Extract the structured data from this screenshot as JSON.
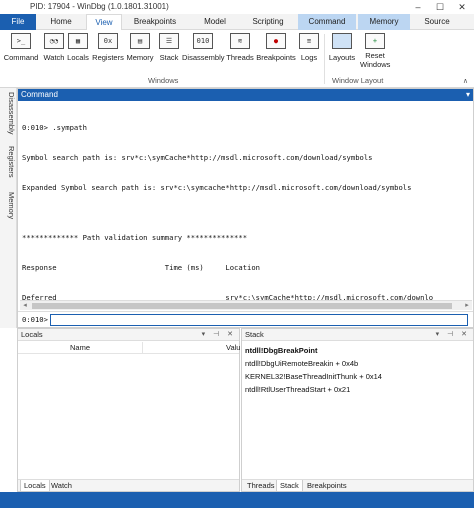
{
  "window": {
    "title": "PID: 17904 - WinDbg (1.0.1801.31001)",
    "min_glyph": "–",
    "max_glyph": "☐",
    "close_glyph": "✕"
  },
  "ribbon_tabs": [
    "File",
    "Home",
    "View",
    "Breakpoints",
    "Model",
    "Scripting",
    "Command",
    "Memory",
    "Source"
  ],
  "ribbon": {
    "buttons": [
      {
        "label": "Command",
        "icon": "command-icon",
        "glyph": ">_"
      },
      {
        "label": "Watch",
        "icon": "watch-icon",
        "glyph": "◔◔"
      },
      {
        "label": "Locals",
        "icon": "locals-icon",
        "glyph": "▦"
      },
      {
        "label": "Registers",
        "icon": "registers-icon",
        "glyph": "0x"
      },
      {
        "label": "Memory",
        "icon": "memory-icon",
        "glyph": "▤"
      },
      {
        "label": "Stack",
        "icon": "stack-icon",
        "glyph": "☰"
      },
      {
        "label": "Disassembly",
        "icon": "disassembly-icon",
        "glyph": "010"
      },
      {
        "label": "Threads",
        "icon": "threads-icon",
        "glyph": "≋"
      },
      {
        "label": "Breakpoints",
        "icon": "breakpoints-icon",
        "glyph": "●"
      },
      {
        "label": "Logs",
        "icon": "logs-icon",
        "glyph": "≡"
      }
    ],
    "layouts_label": "Layouts",
    "reset_line1": "Reset",
    "reset_line2": "Windows",
    "group_windows": "Windows",
    "group_layout": "Window Layout"
  },
  "side_tabs": [
    "Disassembly",
    "Registers",
    "Memory"
  ],
  "command_window": {
    "title": "Command",
    "lines": [
      "0:010> .sympath",
      "Symbol search path is: srv*c:\\symCache*http://msdl.microsoft.com/download/symbols",
      "Expanded Symbol search path is: srv*c:\\symcache*http://msdl.microsoft.com/download/symbols",
      "",
      "************* Path validation summary **************",
      "Response                         Time (ms)     Location",
      "Deferred                                       srv*c:\\symCache*http://msdl.microsoft.com/downlo"
    ],
    "prompt": "0:010>",
    "input_value": ""
  },
  "locals": {
    "title": "Locals",
    "col_name": "Name",
    "col_value": "Valu",
    "tabs": [
      "Locals",
      "Watch"
    ]
  },
  "stack": {
    "title": "Stack",
    "frames": [
      "ntdll!DbgBreakPoint",
      "ntdll!DbgUiRemoteBreakin + 0x4b",
      "KERNEL32!BaseThreadInitThunk + 0x14",
      "ntdll!RtlUserThreadStart + 0x21"
    ],
    "tabs": [
      "Threads",
      "Stack",
      "Breakpoints"
    ]
  },
  "pane_controls": "▾ ⊣ ✕",
  "colors": {
    "accent": "#1b5fb0",
    "context_tab": "#bcd6f2"
  }
}
